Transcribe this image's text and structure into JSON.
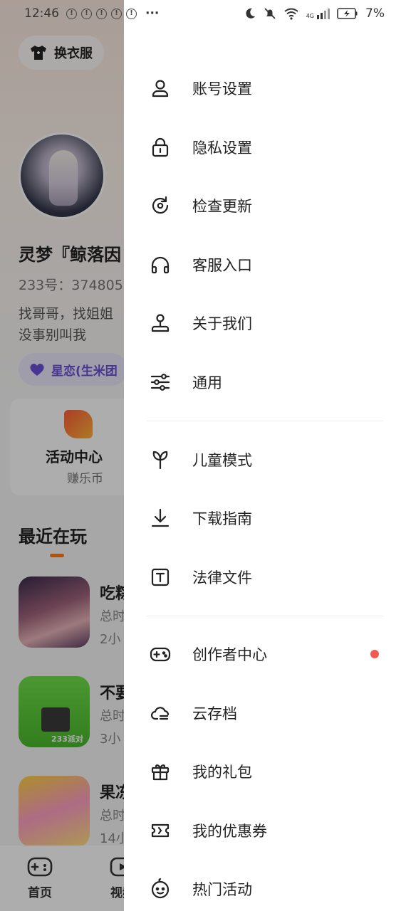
{
  "status_bar": {
    "time": "12:46",
    "notif_icons": [
      "!",
      "!",
      "!",
      "!",
      "!"
    ],
    "overflow": "···",
    "network": "4G",
    "battery": "7%"
  },
  "background": {
    "wardrobe_label": "换衣服",
    "nickname": "灵梦『鲸落因",
    "uid": "233号：374805",
    "bio_line1": "找哥哥，找姐姐",
    "bio_line2": "没事别叫我",
    "star_badge": "星恋(生米团",
    "activity_title": "活动中心",
    "activity_sub": "赚乐币",
    "recent_title": "最近在玩",
    "games": [
      {
        "name": "吃粽",
        "line1": "总时",
        "line2": "2小"
      },
      {
        "name": "不要",
        "line1": "总时",
        "line2": "3小",
        "thumb_text": "233派对"
      },
      {
        "name": "果冻",
        "line1": "总时",
        "line2": "14小"
      }
    ],
    "nav": [
      {
        "label": "首页"
      },
      {
        "label": "视频"
      }
    ]
  },
  "drawer": {
    "items": [
      {
        "label": "账号设置",
        "icon": "user-icon"
      },
      {
        "label": "隐私设置",
        "icon": "lock-icon"
      },
      {
        "label": "检查更新",
        "icon": "refresh-icon"
      },
      {
        "label": "客服入口",
        "icon": "headphones-icon"
      },
      {
        "label": "关于我们",
        "icon": "joystick-icon"
      },
      {
        "label": "通用",
        "icon": "sliders-icon"
      },
      {
        "label": "儿童模式",
        "icon": "sprout-icon"
      },
      {
        "label": "下载指南",
        "icon": "download-icon"
      },
      {
        "label": "法律文件",
        "icon": "document-t-icon"
      },
      {
        "label": "创作者中心",
        "icon": "gamepad-icon",
        "badge": true
      },
      {
        "label": "云存档",
        "icon": "cloud-icon"
      },
      {
        "label": "我的礼包",
        "icon": "gift-icon"
      },
      {
        "label": "我的优惠券",
        "icon": "ticket-icon"
      },
      {
        "label": "热门活动",
        "icon": "smile-icon"
      }
    ]
  },
  "colors": {
    "accent_orange": "#ff7a1a",
    "badge_red": "#f25a50",
    "star_purple": "#6a4fd6"
  }
}
